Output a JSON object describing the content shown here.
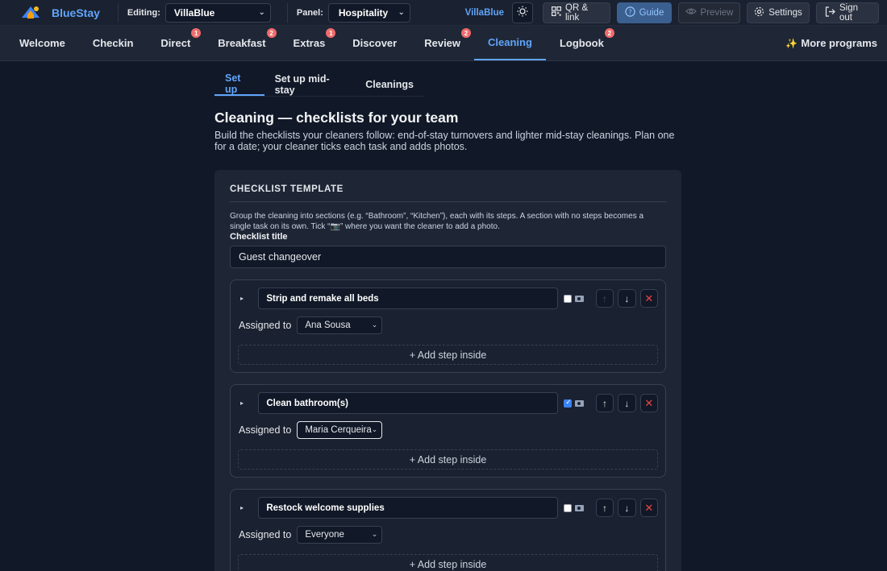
{
  "app": {
    "name": "BlueStay"
  },
  "topbar": {
    "editing_label": "Editing:",
    "editing_value": "VillaBlue",
    "panel_label": "Panel:",
    "panel_value": "Hospitality",
    "tenant": "VillaBlue",
    "qr_label": "QR & link",
    "guide_label": "Guide",
    "preview_label": "Preview",
    "settings_label": "Settings",
    "signout_label": "Sign out"
  },
  "nav": {
    "items": [
      {
        "label": "Welcome",
        "badge": ""
      },
      {
        "label": "Checkin",
        "badge": ""
      },
      {
        "label": "Direct",
        "badge": "1"
      },
      {
        "label": "Breakfast",
        "badge": "2"
      },
      {
        "label": "Extras",
        "badge": "1"
      },
      {
        "label": "Discover",
        "badge": ""
      },
      {
        "label": "Review",
        "badge": "2"
      },
      {
        "label": "Cleaning",
        "badge": ""
      },
      {
        "label": "Logbook",
        "badge": "2"
      }
    ],
    "active": "Cleaning",
    "more_label": "More programs"
  },
  "subtabs": [
    "Set up",
    "Set up mid-stay",
    "Cleanings"
  ],
  "page": {
    "title": "Cleaning — checklists for your team",
    "description": "Build the checklists your cleaners follow: end-of-stay turnovers and lighter mid-stay cleanings. Plan one for a date; your cleaner ticks each task and adds photos."
  },
  "card": {
    "heading": "CHECKLIST TEMPLATE",
    "help": "Group the cleaning into sections (e.g. “Bathroom”, “Kitchen”), each with its steps. A section with no steps becomes a single task on its own. Tick “📷” where you want the cleaner to add a photo.",
    "title_label": "Checklist title",
    "title_value": "Guest changeover",
    "assigned_label": "Assigned to",
    "add_step_label": "+ Add step inside",
    "tasks": [
      {
        "name": "Strip and remake all beds",
        "photo": false,
        "assignee": "Ana Sousa"
      },
      {
        "name": "Clean bathroom(s)",
        "photo": true,
        "assignee": "Maria Cerqueira"
      },
      {
        "name": "Restock welcome supplies",
        "photo": false,
        "assignee": "Everyone"
      }
    ]
  },
  "colors": {
    "accent": "#60a5fa",
    "badge": "#ef6b6b",
    "danger": "#ef4444",
    "background": "#111827"
  }
}
